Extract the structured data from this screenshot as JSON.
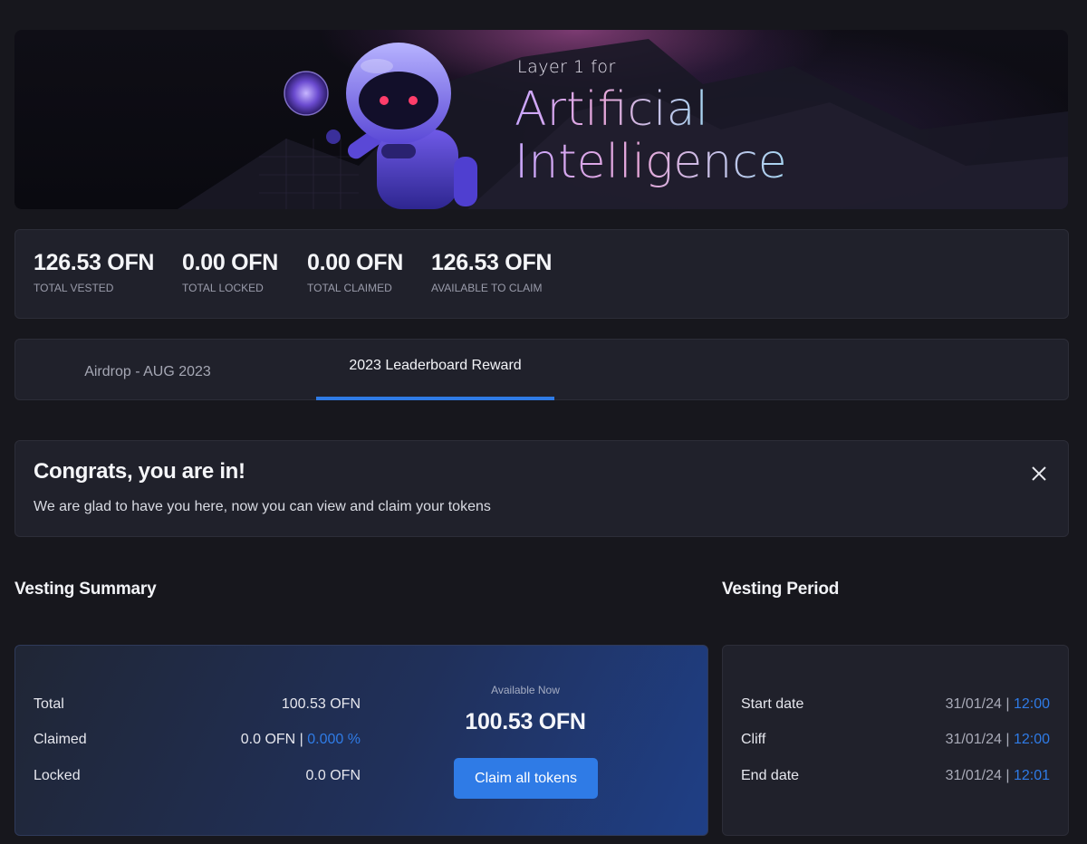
{
  "banner": {
    "line_small": "Layer 1 for",
    "line_big_1": "Artificial",
    "line_big_2": "Intelligence"
  },
  "stats": [
    {
      "value": "126.53 OFN",
      "label": "TOTAL VESTED"
    },
    {
      "value": "0.00 OFN",
      "label": "TOTAL LOCKED"
    },
    {
      "value": "0.00 OFN",
      "label": "TOTAL CLAIMED"
    },
    {
      "value": "126.53 OFN",
      "label": "AVAILABLE TO CLAIM"
    }
  ],
  "tabs": [
    {
      "label": "Airdrop - AUG 2023",
      "active": false
    },
    {
      "label": "2023 Leaderboard Reward",
      "active": true
    }
  ],
  "alert": {
    "title": "Congrats, you are in!",
    "message": "We are glad to have you here, now you can view and claim your tokens",
    "close_icon": "close-icon"
  },
  "vesting_summary": {
    "title": "Vesting Summary",
    "rows": {
      "total": {
        "label": "Total",
        "value": "100.53 OFN"
      },
      "claimed": {
        "label": "Claimed",
        "value": "0.0 OFN |",
        "percent": "0.000 %"
      },
      "locked": {
        "label": "Locked",
        "value": "0.0 OFN"
      }
    },
    "available_label": "Available Now",
    "available_value": "100.53 OFN",
    "claim_button": "Claim all tokens"
  },
  "vesting_period": {
    "title": "Vesting Period",
    "rows": [
      {
        "label": "Start date",
        "date": "31/01/24 |",
        "time": "12:00"
      },
      {
        "label": "Cliff",
        "date": "31/01/24 |",
        "time": "12:00"
      },
      {
        "label": "End date",
        "date": "31/01/24 |",
        "time": "12:01"
      }
    ]
  },
  "colors": {
    "accent": "#2f7be6",
    "background": "#17171d",
    "card": "#20212b"
  }
}
